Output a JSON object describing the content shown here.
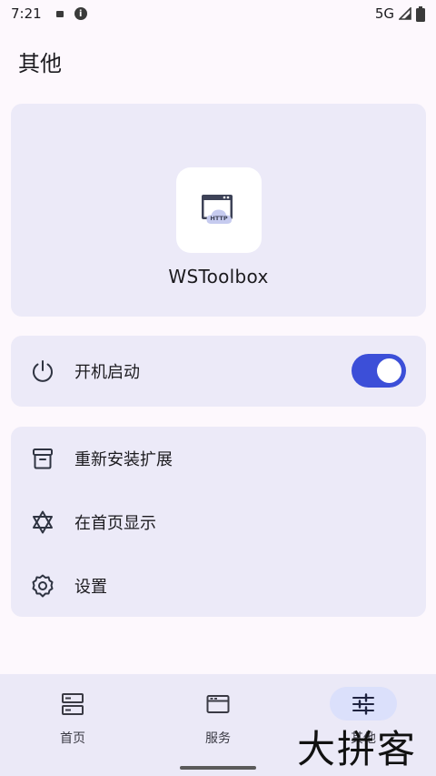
{
  "status_bar": {
    "time": "7:21",
    "network": "5G"
  },
  "page": {
    "title": "其他"
  },
  "app_card": {
    "name": "WSToolbox",
    "icon_text": "HTTP"
  },
  "autostart": {
    "label": "开机启动",
    "enabled": true
  },
  "menu": {
    "items": [
      {
        "label": "重新安装扩展",
        "icon": "archive-box-icon"
      },
      {
        "label": "在首页显示",
        "icon": "star-of-david-icon"
      },
      {
        "label": "设置",
        "icon": "gear-icon"
      }
    ]
  },
  "bottom_nav": {
    "items": [
      {
        "label": "首页",
        "icon": "server-stack-icon",
        "active": false
      },
      {
        "label": "服务",
        "icon": "browser-window-icon",
        "active": false
      },
      {
        "label": "其他",
        "icon": "sliders-icon",
        "active": true
      }
    ]
  },
  "watermark": {
    "text": "大拼客"
  },
  "colors": {
    "accent": "#3c4fd8",
    "card_bg": "#eceaf8",
    "page_bg": "#fdf8fd"
  }
}
